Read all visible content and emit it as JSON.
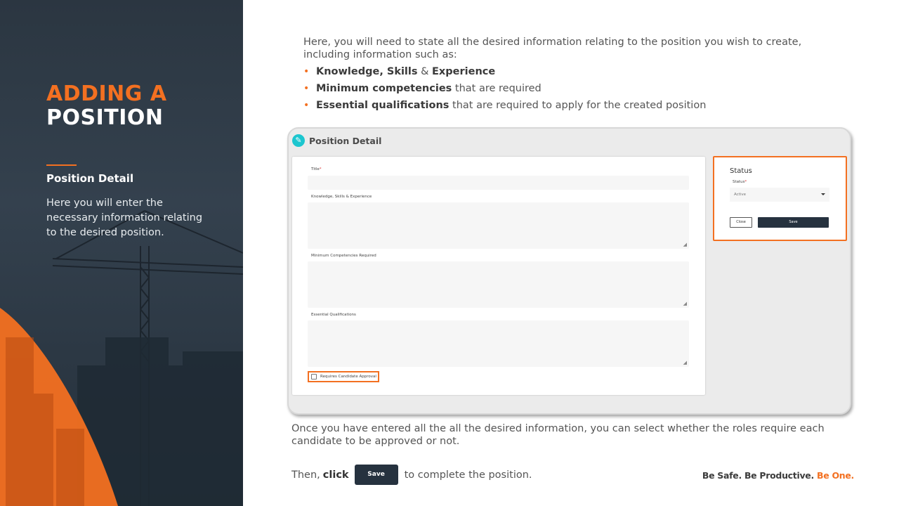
{
  "sidebar": {
    "title_line1": "ADDING A",
    "title_line2": "POSITION",
    "heading": "Position Detail",
    "description": "Here you will enter the necessary information relating to the desired position."
  },
  "main": {
    "intro": "Here, you will need to state all the desired information relating to the position you wish to create, including information such as:",
    "bullets": [
      {
        "bold": "Knowledge, Skills",
        "connector": " & ",
        "bold2": "Experience",
        "rest": ""
      },
      {
        "bold": "Minimum competencies",
        "rest": " that are required"
      },
      {
        "bold": "Essential qualifications",
        "rest": " that are required to apply for the created position"
      }
    ],
    "outro": "Once you have entered all the all the desired information, you can select whether the roles require each candidate to be approved or not.",
    "then_prefix": "Then,",
    "then_click": "click",
    "save_label": "Save",
    "then_suffix": "to complete the position.",
    "slogan_dark": "Be Safe. Be Productive.",
    "slogan_orange": "Be One."
  },
  "screenshot": {
    "header_title": "Position Detail",
    "form": {
      "title_label": "Title",
      "required_mark": "*",
      "kse_label": "Knowledge, Skills & Experience",
      "competencies_label": "Minimum Competencies Required",
      "qualifications_label": "Essential Qualifications",
      "approval_label": "Requires Candidate Approval"
    },
    "status": {
      "title": "Status",
      "field_label": "Status",
      "required_mark": "*",
      "selected": "Active",
      "close_label": "Close",
      "save_label": "Save"
    }
  },
  "colors": {
    "accent": "#f37021",
    "dark": "#26323f",
    "teal": "#1cc6cf"
  }
}
